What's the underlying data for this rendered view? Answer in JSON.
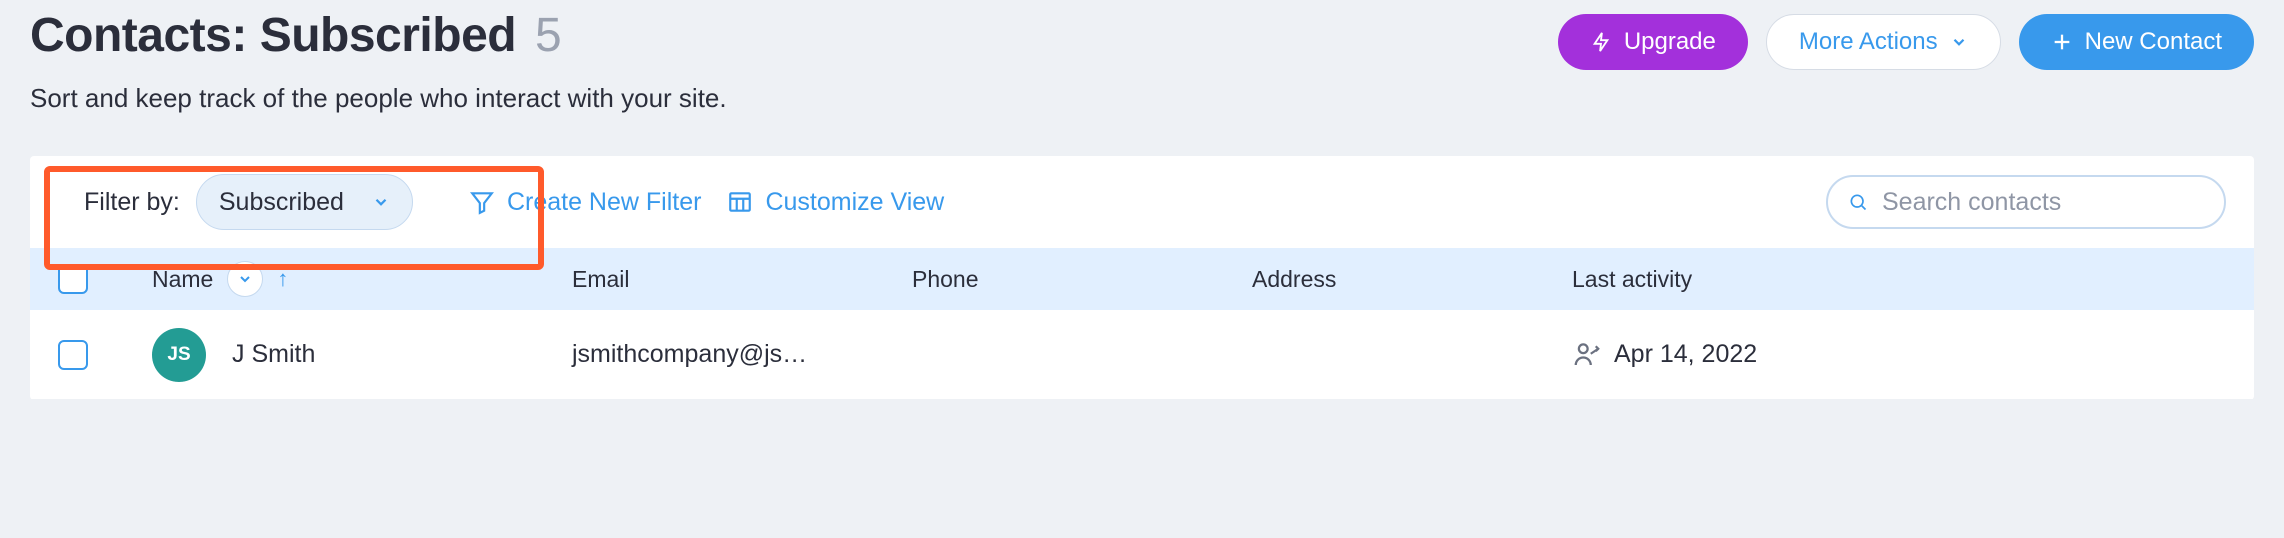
{
  "header": {
    "title_prefix": "Contacts:",
    "title_filter": "Subscribed",
    "count": "5",
    "subtitle": "Sort and keep track of the people who interact with your site.",
    "upgrade_label": "Upgrade",
    "more_actions_label": "More Actions",
    "new_contact_label": "New Contact"
  },
  "toolbar": {
    "filter_by_label": "Filter by:",
    "filter_value": "Subscribed",
    "create_filter_label": "Create New Filter",
    "customize_view_label": "Customize View",
    "search_placeholder": "Search contacts"
  },
  "columns": {
    "name": "Name",
    "email": "Email",
    "phone": "Phone",
    "address": "Address",
    "last_activity": "Last activity"
  },
  "rows": [
    {
      "avatar_initials": "JS",
      "name": "J Smith",
      "email": "jsmithcompany@js…",
      "phone": "",
      "address": "",
      "last_activity": "Apr 14, 2022"
    }
  ]
}
